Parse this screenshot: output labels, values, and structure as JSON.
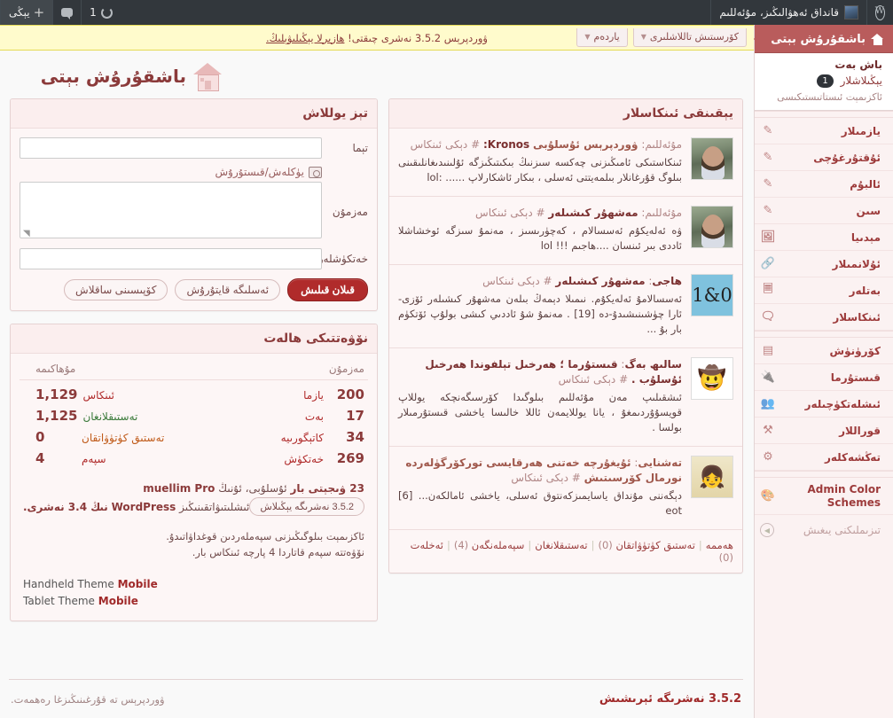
{
  "adminbar": {
    "site_title": "قانداق ئەھۋالىڭىز، مۇئەللىم",
    "updates_count": "1",
    "new_label": "يېڭى",
    "wp_logo_icon": "wordpress-logo-icon",
    "comments_icon": "comment-bubble-icon",
    "updates_icon": "refresh-icon",
    "plus_icon": "plus-icon"
  },
  "sidebar": {
    "current": {
      "label": "باشقۇرۇش بېتى",
      "icon": "home-icon"
    },
    "submenu": [
      {
        "label": "باش بەت",
        "current": true
      },
      {
        "label": "يېڭىلاشلار",
        "badge": "1"
      },
      {
        "label": "ئاكزىمېت ئىستاتىستىكىسى",
        "dim": true
      }
    ],
    "items": [
      {
        "label": "يازمىلار",
        "icon": "pin-icon"
      },
      {
        "label": "ئۇقتۇرغۇچى",
        "icon": "pin-icon"
      },
      {
        "label": "ئالبۇم",
        "icon": "pin-icon"
      },
      {
        "label": "سىن",
        "icon": "pin-icon"
      },
      {
        "label": "مېدىيا",
        "icon": "media-icon"
      },
      {
        "label": "ئۇلانمىلار",
        "icon": "link-icon"
      },
      {
        "label": "بەتلەر",
        "icon": "pages-icon"
      },
      {
        "label": "ئىنكاسلار",
        "icon": "comment-icon"
      }
    ],
    "items2": [
      {
        "label": "كۆرۈنۈش",
        "icon": "appearance-icon"
      },
      {
        "label": "قىستۇرما",
        "icon": "plugin-icon"
      },
      {
        "label": "ئىشلەتكۈچىلەر",
        "icon": "users-icon"
      },
      {
        "label": "قوراللار",
        "icon": "tools-icon"
      },
      {
        "label": "تەڭشەكلەر",
        "icon": "settings-icon"
      }
    ],
    "color_schemes": {
      "label": "Admin Color Schemes",
      "icon": "palette-icon"
    },
    "collapse": {
      "label": "تىزىملىكنى يىغىش",
      "icon": "collapse-arrow-icon"
    }
  },
  "nag": {
    "screen_options": "كۆرسىتىش تاللاشلىرى",
    "help": "ياردەم",
    "message_prefix": "ۋوردپرېس 3.5.2 نەشرى چىقتى! ",
    "message_link": "ھازىرلا يېڭىلىۋېلىڭ."
  },
  "page": {
    "title": "باشقۇرۇش بېتى",
    "home_icon": "home-icon"
  },
  "quick_draft": {
    "heading": "تېز يوللاش",
    "title_label": "تېما",
    "title_value": "",
    "media_label": "يۈكلەش/قىستۇرۇش",
    "media_icon": "camera-icon",
    "content_label": "مەزمۇن",
    "content_value": "",
    "tags_label": "خەتكۈشلەر",
    "tags_value": "",
    "publish_label": "قىلان قىلىش",
    "save_draft_label": "ئەسلىگە قايتۇرۇش",
    "reset_label": "كۆپىسىنى ساقلاش"
  },
  "right_now": {
    "heading": "نۆۋەتتىكى ھالەت",
    "col_content_title": "مەزمۇن",
    "col_discussion_title": "مۇھاكىمە",
    "content_rows": [
      {
        "num": "200",
        "label": "يازما",
        "color": "red"
      },
      {
        "num": "17",
        "label": "بەت",
        "color": "red"
      },
      {
        "num": "34",
        "label": "كاتېگورىيە",
        "color": "red"
      },
      {
        "num": "269",
        "label": "خەتكۈش",
        "color": "red"
      }
    ],
    "discussion_rows": [
      {
        "num": "1,129",
        "label": "ئىنكاس",
        "color": "red"
      },
      {
        "num": "1,125",
        "label": "تەستىقلانغان",
        "color": "green"
      },
      {
        "num": "0",
        "label": "تەستىق كۈتۈۋاتقان",
        "color": "orange"
      },
      {
        "num": "4",
        "label": "سپەم",
        "color": "red"
      }
    ],
    "theme_line_prefix": "ئۇسلۇبى، ئۇنىڭ",
    "theme_name": "muellim Pro",
    "theme_widgets": "23 ۋىجېتى بار",
    "wp_line_prefix": "ئىشلىتىۋاتقىنىڭىز",
    "wp_name": "WordPress",
    "wp_version_text": "نىڭ 3.4 نەشرى.",
    "update_button": "3.5.2 نەشرىگە يېڭىلاش",
    "note_line1": "ئاكزىمېت بىلوگىڭىزنى سپەملەردىن قوغداۋاتىدۇ.",
    "note_line2": "نۆۋەتتە سپەم قاتاردا 4 پارچە ئىنكاس بار.",
    "mobile_handheld_brand": "Mobile",
    "mobile_handheld_label": "Handheld Theme",
    "mobile_tablet_brand": "Mobile",
    "mobile_tablet_label": "Tablet Theme"
  },
  "recent_comments": {
    "heading": "يېقىنقى ئىنكاسلار",
    "items": [
      {
        "avatar": "photo-male-avatar",
        "author": "مۇئەللىم",
        "on_text": "ۋوردپرېس ئۇسلۇبى",
        "post": "Kronos:",
        "suffix": "# دېكى ئىنكاس",
        "text": "ئىنكاستىكى ئامىڭىزنى چەكسە سىزنىڭ بىكىتىڭىزگە ئۇلىنىدىغانلىقىنى بىلوگ قۇرغانلار بىلمەيتتى ئەسلى ، بىكار ئاشكارلاپ ...... :lol"
      },
      {
        "avatar": "photo-male-avatar",
        "author": "مۇئەللىم",
        "post": "مەشھۇر كىشىلەر",
        "suffix": "# دېكى ئىنكاس",
        "text": "ۋە ئەلەيكۇم ئەسسالام ، كەچۈرىسىز ، مەنمۇ سىزگە ئوخشاشلا ئاددى بىر ئىنسان ....ھاجىم !!! lol"
      },
      {
        "avatar": "ol-text-avatar",
        "avatar_text": "0&1",
        "author": "ھاجى",
        "post": "مەشھۇر كىشىلەر",
        "suffix": "# دېكى ئىنكاس",
        "text": "ئەسسالامۇ ئەلەيكۇم. نىمىلا دېمەڭ بىلەن مەشھۇر كىشىلەر ئۆزى-ئارا چۈشىنىشىدۇ-دە [19] . مەنمۇ شۇ ئاددىي كىشى بولۇپ ئۆتكۈم بار بۇ ..."
      },
      {
        "avatar": "cartoon-avatar",
        "author": "سالىھ بەگ",
        "post": "قىستۇرما ؛ ھەرخىل تېلفوندا ھەرخىل ئۇسلۇب .",
        "suffix": "# دېكى ئىنكاس",
        "text": "ئىشقىلىپ مەن مۇئەللىم بىلوگىدا كۆرسىگەنچكە يوللاپ قويسۇۇردىمغۇ ، يانا يوللايمەن ئاللا خالىسا ياخشى قىستۇرمىلار بولسا ."
      },
      {
        "avatar": "anime-avatar",
        "author": "تەشنايى",
        "post": "ئۇيغۇرچە خەتنى ھەرقايسى توركۆرگۈلەردە نورمال كۆرسىتىش",
        "suffix": "# دېكى ئىنكاس",
        "text": "دېگەننى مۇنداق ياسايمىزكەنتوق ئەسلى، ياخشى ئامالكەن... [6] eot"
      }
    ],
    "filters": [
      {
        "label": "ھەممە",
        "count": ""
      },
      {
        "label": "تەستىق كۈتۈۋاتقان",
        "count": "(0)"
      },
      {
        "label": "تەستىقلانغان",
        "count": ""
      },
      {
        "label": "سپەملەنگەن",
        "count": "(4)"
      },
      {
        "label": "ئەخلەت",
        "count": "(0)"
      }
    ]
  },
  "footer": {
    "thanks": "ۋوردپرېس تە قۇرغىنىڭىزغا رەھمەت.",
    "version": "3.5.2 نەشرىگە ئېرىشىش"
  }
}
